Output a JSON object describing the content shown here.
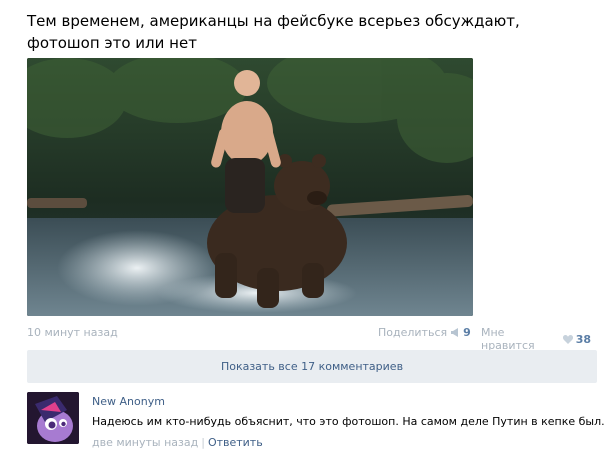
{
  "post": {
    "text_line1": "Тем временем, американцы на фейсбуке всерьез обсуждают,",
    "text_line2": "фотошоп это или нет",
    "time": "10 минут назад",
    "share_label": "Поделиться",
    "share_count": "9",
    "like_label": "Мне нравится",
    "like_count": "38",
    "share_icon": "megaphone-icon",
    "like_icon": "heart-icon"
  },
  "comments_bar": {
    "label": "Показать все 17 комментариев"
  },
  "comment": {
    "author": "New Anonym",
    "text": "Надеюсь им кто-нибудь объяснит, что это фотошоп. На самом деле Путин в кепке был.",
    "time": "две минуты назад",
    "separator": "|",
    "reply_label": "Ответить"
  },
  "colors": {
    "link": "#3f5f87",
    "muted": "#a9b3bd",
    "bar_bg": "#e9edf1"
  }
}
